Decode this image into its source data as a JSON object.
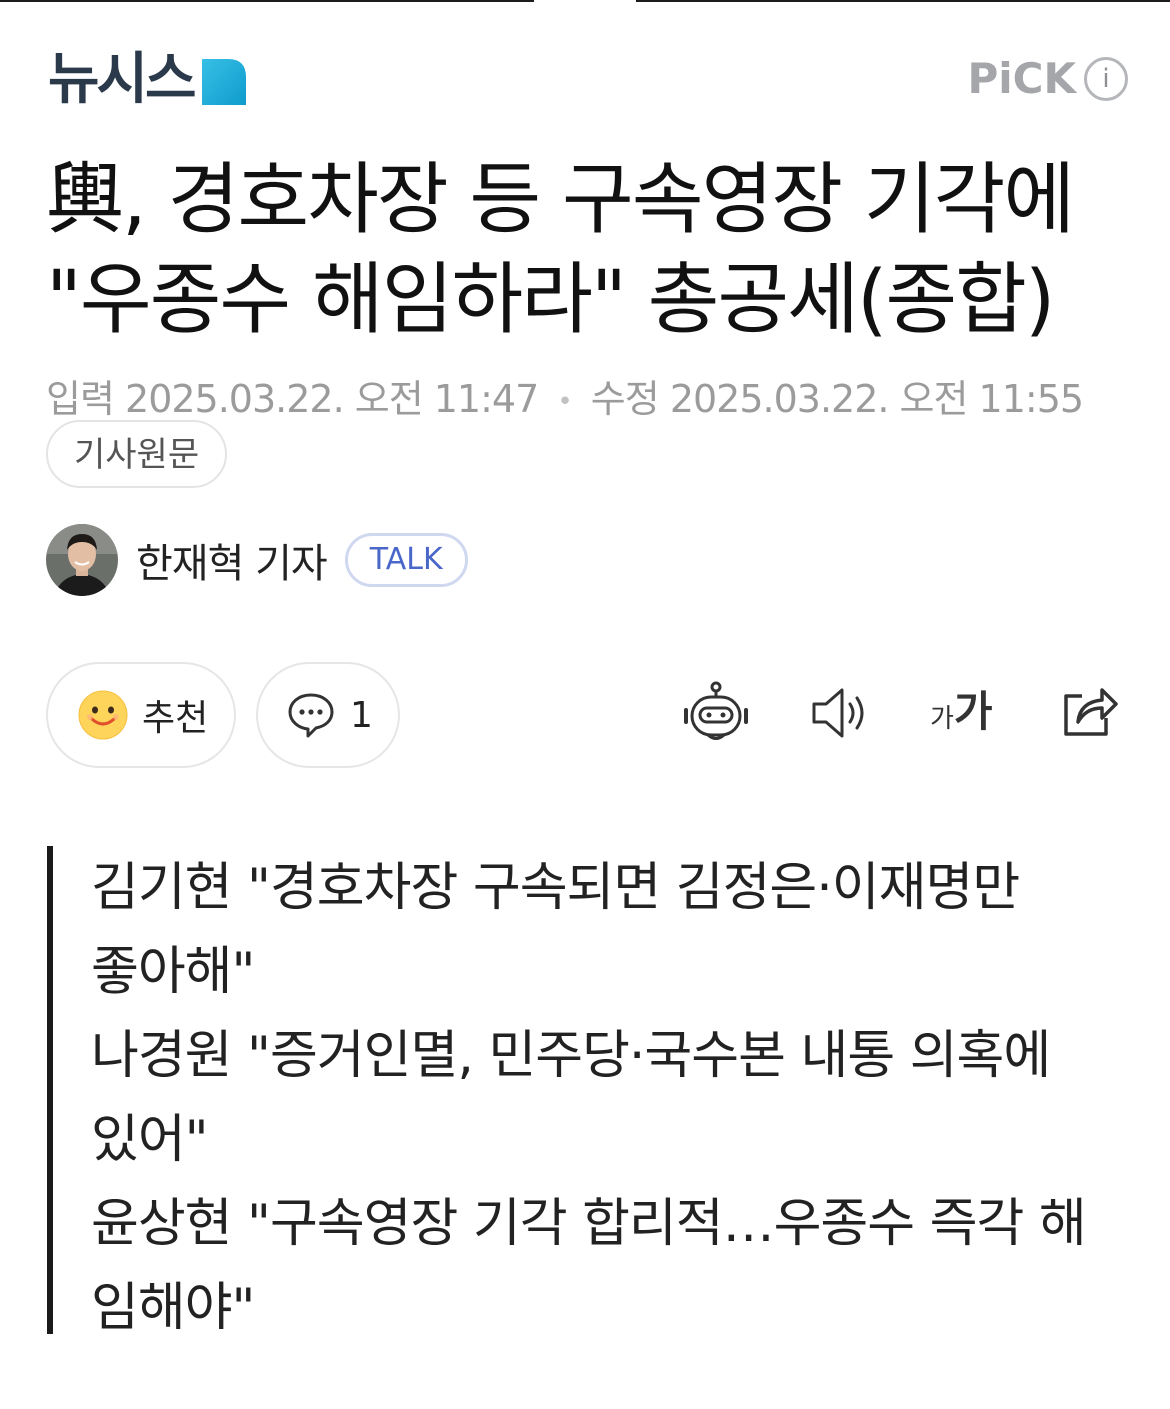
{
  "header": {
    "logo_text": "뉴시스",
    "pick_label": "PiCK",
    "info_glyph": "i"
  },
  "article": {
    "headline": "輿, 경호차장 등 구속영장 기각에\n\"우종수 해임하라\" 총공세(종합)",
    "input_label": "입력",
    "input_date": "2025.03.22. 오전 11:47",
    "separator": "•",
    "modified_label": "수정",
    "modified_date": "2025.03.22. 오전 11:55",
    "original_link": "기사원문"
  },
  "author": {
    "name": "한재혁 기자",
    "talk_label": "TALK"
  },
  "actions": {
    "recommend_label": "추천",
    "comment_count": "1",
    "font_size_label_small": "가",
    "font_size_label_large": "가"
  },
  "summary": {
    "lines": [
      "김기현 \"경호차장 구속되면 김정은·이재명만",
      "좋아해\"",
      "나경원 \"증거인멸, 민주당·국수본 내통 의혹에",
      "있어\"",
      "윤상현 \"구속영장 기각 합리적…우종수 즉각 해",
      "임해야\""
    ]
  },
  "icons": {
    "logo_mark": "newsis-logo-mark",
    "info": "info-icon",
    "smile": "smile-icon",
    "comment": "comment-icon",
    "bot": "ai-bot-icon",
    "speaker": "speaker-icon",
    "font_size": "font-size-icon",
    "share": "share-icon"
  },
  "colors": {
    "logo_text": "#2b3a4a",
    "logo_mark": "#17a9d8",
    "talk_text": "#4966c9",
    "meta_gray": "#9b9b9b",
    "summary_bar": "#1a1a1a"
  }
}
